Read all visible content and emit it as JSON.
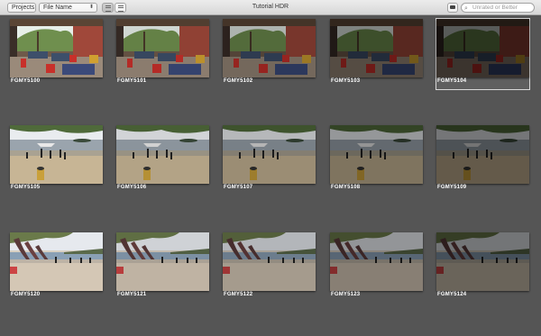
{
  "toolbar": {
    "projects_label": "Projects",
    "sort_label": "File Name",
    "title": "Tutorial HDR",
    "search_placeholder": "Unrated or Better",
    "icons": {
      "grid_view": "grid-view-icon",
      "list_view": "list-view-icon",
      "camera": "camera-icon",
      "search": "search-icon"
    }
  },
  "rows": [
    {
      "scene": "restaurant",
      "items": [
        {
          "name": "FGMY5100",
          "brightness": 1.0
        },
        {
          "name": "FGMY5101",
          "brightness": 0.9
        },
        {
          "name": "FGMY5102",
          "brightness": 0.75
        },
        {
          "name": "FGMY5103",
          "brightness": 0.55
        },
        {
          "name": "FGMY5104",
          "brightness": 0.38
        }
      ]
    },
    {
      "scene": "beach",
      "items": [
        {
          "name": "FGMY5105",
          "brightness": 1.0
        },
        {
          "name": "FGMY5106",
          "brightness": 0.9
        },
        {
          "name": "FGMY5107",
          "brightness": 0.78
        },
        {
          "name": "FGMY5108",
          "brightness": 0.64
        },
        {
          "name": "FGMY5109",
          "brightness": 0.5
        }
      ]
    },
    {
      "scene": "shore",
      "items": [
        {
          "name": "FGMY5120",
          "brightness": 1.0
        },
        {
          "name": "FGMY5121",
          "brightness": 0.9
        },
        {
          "name": "FGMY5122",
          "brightness": 0.78
        },
        {
          "name": "FGMY5123",
          "brightness": 0.64
        },
        {
          "name": "FGMY5124",
          "brightness": 0.5
        }
      ]
    }
  ],
  "selected": "FGMY5104"
}
